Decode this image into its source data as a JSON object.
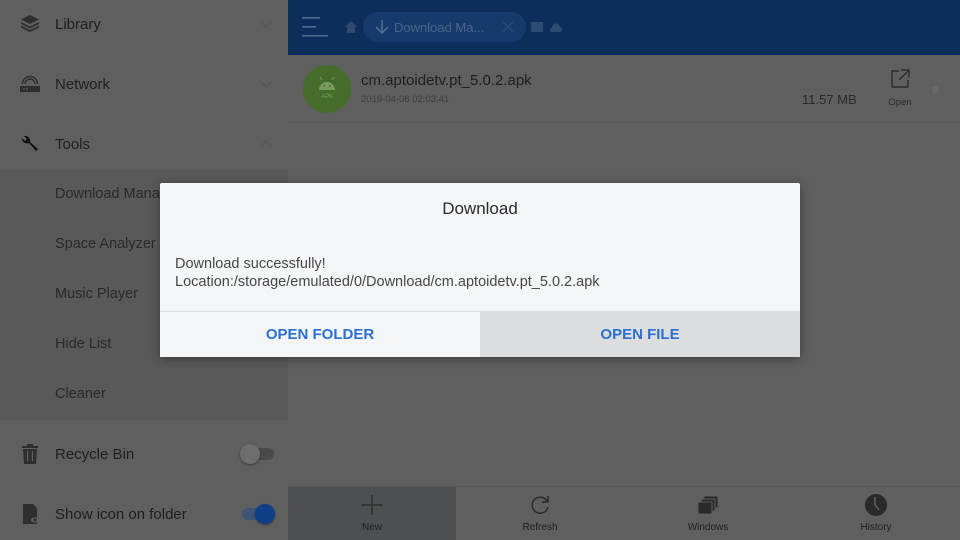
{
  "sidebar": {
    "sections": [
      {
        "label": "Library",
        "icon": "layers-icon",
        "expanded": false
      },
      {
        "label": "Network",
        "icon": "router-icon",
        "expanded": false
      },
      {
        "label": "Tools",
        "icon": "wrench-icon",
        "expanded": true
      }
    ],
    "tools_items": [
      {
        "label": "Download Mana"
      },
      {
        "label": "Space Analyzer"
      },
      {
        "label": "Music Player"
      },
      {
        "label": "Hide List"
      },
      {
        "label": "Cleaner"
      }
    ],
    "toggles": [
      {
        "label": "Recycle Bin",
        "icon": "trash-icon",
        "on": false
      },
      {
        "label": "Show icon on folder",
        "icon": "folder-eye-icon",
        "on": true
      }
    ]
  },
  "header": {
    "breadcrumb_label": "Download Ma...",
    "colors": {
      "background": "#0d2e5a"
    }
  },
  "file": {
    "name": "cm.aptoidetv.pt_5.0.2.apk",
    "date": "2019-04-08 02:03:41",
    "size": "11.57 MB",
    "type_label": "APK",
    "open_label": "Open"
  },
  "bottombar": {
    "items": [
      {
        "label": "New",
        "icon": "plus-icon",
        "active": true
      },
      {
        "label": "Refresh",
        "icon": "refresh-icon",
        "active": false
      },
      {
        "label": "Windows",
        "icon": "windows-icon",
        "active": false
      },
      {
        "label": "History",
        "icon": "clock-icon",
        "active": false
      }
    ]
  },
  "dialog": {
    "title": "Download",
    "message_line1": "Download  successfully!",
    "message_line2": "Location:/storage/emulated/0/Download/cm.aptoidetv.pt_5.0.2.apk",
    "buttons": {
      "open_folder": "OPEN FOLDER",
      "open_file": "OPEN FILE"
    },
    "colors": {
      "button_text": "#2a6fd1",
      "focused_button_bg": "#dcdddf"
    }
  }
}
